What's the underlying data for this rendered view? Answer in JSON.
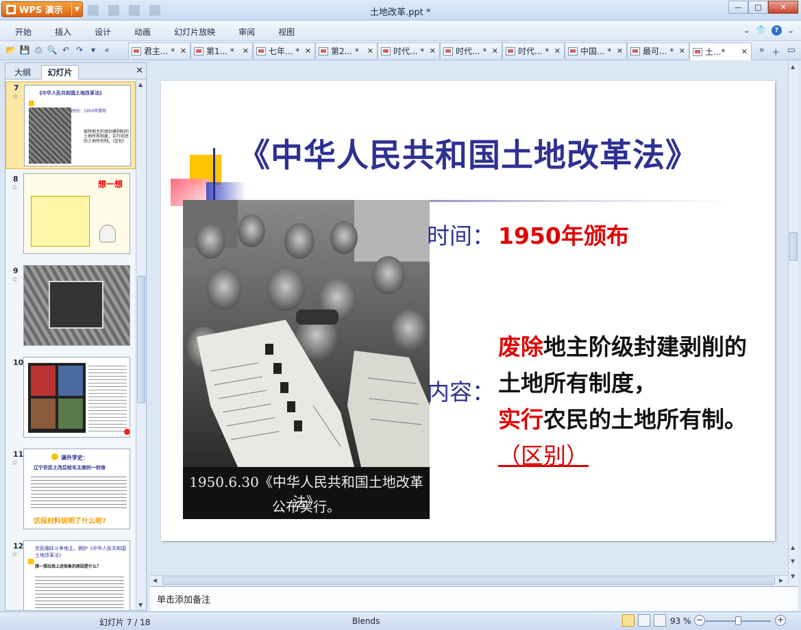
{
  "app": {
    "name": "WPS 演示",
    "window_title": "土地改革.ppt *"
  },
  "menu": [
    "开始",
    "插入",
    "设计",
    "动画",
    "幻灯片放映",
    "审阅",
    "视图"
  ],
  "doc_tabs": [
    {
      "label": "君主... *",
      "active": false
    },
    {
      "label": "第1... *",
      "active": false
    },
    {
      "label": "七年... *",
      "active": false
    },
    {
      "label": "第2... *",
      "active": false
    },
    {
      "label": "时代... *",
      "active": false
    },
    {
      "label": "时代... *",
      "active": false
    },
    {
      "label": "时代... *",
      "active": false
    },
    {
      "label": "中国... *",
      "active": false
    },
    {
      "label": "最可... *",
      "active": false
    },
    {
      "label": "土...*",
      "active": true
    }
  ],
  "left_pane": {
    "tabs": [
      "大纲",
      "幻灯片"
    ],
    "thumbnails": [
      {
        "num": "7",
        "title": "《中华人民共和国土地改革法》",
        "line1": "时间：1950年颁布",
        "line2": "废除地主阶级封建剥削的土地所有制度，实行农民的土地所有制。（区别）",
        "selected": true
      },
      {
        "num": "8",
        "title": "想一想",
        "line1": "",
        "line2": "",
        "selected": false
      },
      {
        "num": "9",
        "title": "",
        "line1": "",
        "line2": "",
        "selected": false
      },
      {
        "num": "10",
        "title": "",
        "line1": "",
        "line2": "",
        "selected": false
      },
      {
        "num": "11",
        "title": "课外学史：",
        "line1": "辽宁农民土改后给毛主席的一封信",
        "line2": "这段材料说明了什么呢?",
        "selected": false
      },
      {
        "num": "12",
        "title": "农民踊跃斗争地主，拥护《中华人民共和国土地改革法》",
        "line1": "想一想出现上述现象的原因是什么？",
        "line2": "",
        "selected": false
      }
    ]
  },
  "slide": {
    "title": "《中华人民共和国土地改革法》",
    "photo_caption_line1": "1950.6.30《中华人民共和国土地改革法》",
    "photo_caption_line2": "公布实行。",
    "time_label": "时间：",
    "time_value": "1950年颁布",
    "content_label": "内容：",
    "content_abolish": "废除",
    "content_part1": "地主阶级封建剥削的土地所有制度，",
    "content_implement": "实行",
    "content_part2": "农民的土地所有制。",
    "content_link": "（区别）"
  },
  "notes_placeholder": "单击添加备注",
  "status": {
    "slide_counter": "幻灯片 7 / 18",
    "theme": "Blends",
    "zoom": "93 %"
  },
  "colors": {
    "title_blue": "#2e3192",
    "emphasis_red": "#e00000",
    "accent_orange": "#e06a1b"
  }
}
